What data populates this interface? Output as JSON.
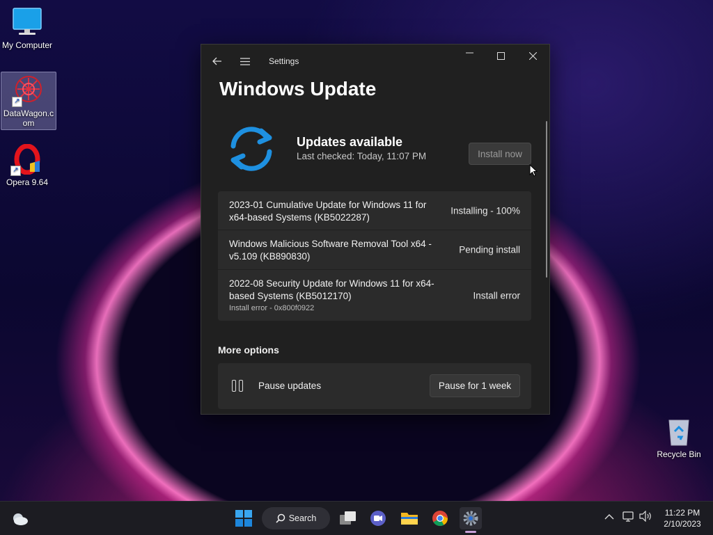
{
  "desktop": {
    "icons": [
      {
        "label": "My Computer",
        "icon": "monitor-icon"
      },
      {
        "label": "DataWagon.com",
        "icon": "datawagon-icon"
      },
      {
        "label": "Opera 9.64",
        "icon": "opera-icon"
      },
      {
        "label": "Recycle Bin",
        "icon": "recycle-bin-icon"
      }
    ]
  },
  "window": {
    "app_title": "Settings",
    "page_title": "Windows Update",
    "status_title": "Updates available",
    "status_sub": "Last checked: Today, 11:07 PM",
    "install_button": "Install now",
    "updates": [
      {
        "name": "2023-01 Cumulative Update for Windows 11 for x64-based Systems (KB5022287)",
        "status": "Installing - 100%",
        "error": ""
      },
      {
        "name": "Windows Malicious Software Removal Tool x64 - v5.109 (KB890830)",
        "status": "Pending install",
        "error": ""
      },
      {
        "name": "2022-08 Security Update for Windows 11 for x64-based Systems (KB5012170)",
        "status": "Install error",
        "error": "Install error - 0x800f0922"
      }
    ],
    "more_options": "More options",
    "pause_label": "Pause updates",
    "pause_button": "Pause for 1 week",
    "accent": "#1e90e0"
  },
  "taskbar": {
    "search_label": "Search",
    "time": "11:22 PM",
    "date": "2/10/2023"
  }
}
